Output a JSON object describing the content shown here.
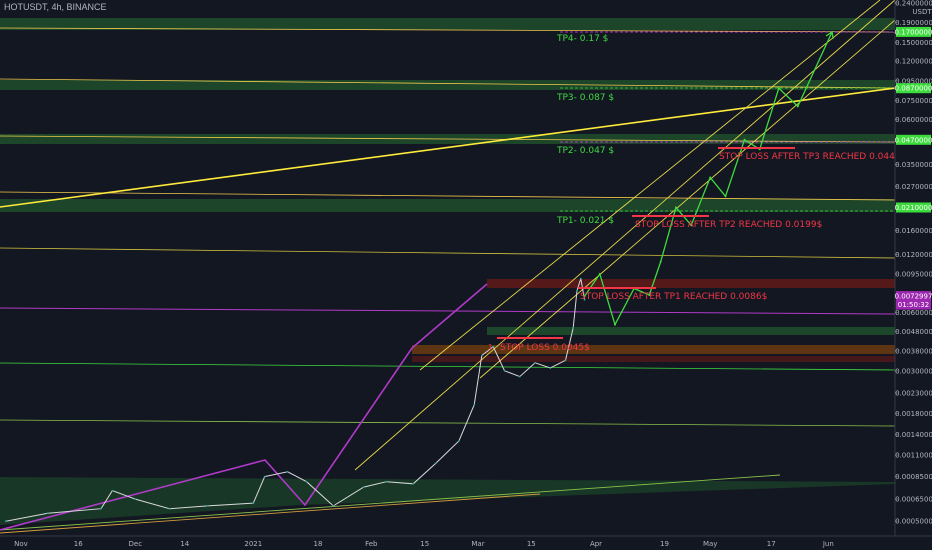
{
  "header": {
    "title": "HOTUSDT, 4h, BINANCE"
  },
  "y_axis": {
    "unit": "USDT",
    "ticks": [
      {
        "label": "0.2400000",
        "v": 0.24
      },
      {
        "label": "0.1900000",
        "v": 0.19
      },
      {
        "label": "0.1500000",
        "v": 0.15
      },
      {
        "label": "0.1200000",
        "v": 0.12
      },
      {
        "label": "0.0950000",
        "v": 0.095
      },
      {
        "label": "0.0750000",
        "v": 0.075
      },
      {
        "label": "0.0600000",
        "v": 0.06
      },
      {
        "label": "0.0350000",
        "v": 0.035
      },
      {
        "label": "0.0270000",
        "v": 0.027
      },
      {
        "label": "0.0160000",
        "v": 0.016
      },
      {
        "label": "0.0120000",
        "v": 0.012
      },
      {
        "label": "0.0095000",
        "v": 0.0095
      },
      {
        "label": "0.0060000",
        "v": 0.006
      },
      {
        "label": "0.0048000",
        "v": 0.0048
      },
      {
        "label": "0.0038000",
        "v": 0.0038
      },
      {
        "label": "0.0030000",
        "v": 0.003
      },
      {
        "label": "0.0023000",
        "v": 0.0023
      },
      {
        "label": "0.0018000",
        "v": 0.0018
      },
      {
        "label": "0.0014000",
        "v": 0.0014
      },
      {
        "label": "0.0011000",
        "v": 0.0011
      },
      {
        "label": "0.0008500",
        "v": 0.00085
      },
      {
        "label": "0.0006500",
        "v": 0.00065
      },
      {
        "label": "0.0005000",
        "v": 0.0005
      }
    ],
    "badges": [
      {
        "label": "0.1700000",
        "v": 0.17,
        "color": "#3ddc3d"
      },
      {
        "label": "0.0870000",
        "v": 0.087,
        "color": "#3ddc3d"
      },
      {
        "label": "0.0470000",
        "v": 0.047,
        "color": "#3ddc3d"
      },
      {
        "label": "0.0210000",
        "v": 0.021,
        "color": "#3ddc3d"
      },
      {
        "label": "0.0072997",
        "v": 0.0073,
        "color": "#9c27b0"
      },
      {
        "label": "01:50:32",
        "v": 0.0066,
        "color": "#9c27b0"
      }
    ]
  },
  "x_axis": {
    "ticks": [
      "Nov",
      "16",
      "Dec",
      "14",
      "2021",
      "18",
      "Feb",
      "15",
      "Mar",
      "15",
      "Apr",
      "19",
      "May",
      "17",
      "Jun"
    ]
  },
  "annotations": {
    "tp4": "TP4- 0.17 $",
    "tp3": "TP3- 0.087 $",
    "tp2": "TP2- 0.047 $",
    "tp1": "TP1- 0.021 $",
    "sl3": "STOP LOSS AFTER TP3 REACHED 0.044$",
    "sl2": "STOP LOSS AFTER TP2 REACHED 0.0199$",
    "sl1": "STOP LOSS AFTER TP1 REACHED 0.0086$",
    "sl0": "STOP LOSS 0.0045$",
    "sl0_prefix": "1"
  },
  "colors": {
    "background": "#131722",
    "zone_green": "#1b5e20",
    "zone_red": "#5d1a1a",
    "zone_orange": "#6b3b10",
    "trend_yellow": "#ffeb3b",
    "trend_purple": "#9c27b0",
    "projection": "#3ddc3d",
    "stop_loss": "#f23645"
  },
  "chart_data": {
    "type": "line",
    "title": "HOTUSDT, 4h, BINANCE",
    "y_scale": "log",
    "ylim": [
      0.00045,
      0.24
    ],
    "xlim": [
      "2020-10-27",
      "2021-06-18"
    ],
    "series": [
      {
        "values": [
          [
            "2020-10-28",
            0.0005
          ],
          [
            "2020-11-08",
            0.00055
          ],
          [
            "2020-11-22",
            0.00058
          ],
          [
            "2020-11-25",
            0.00072
          ],
          [
            "2020-12-01",
            0.00065
          ],
          [
            "2020-12-10",
            0.00058
          ],
          [
            "2020-12-20",
            0.0006
          ],
          [
            "2021-01-01",
            0.00062
          ],
          [
            "2021-01-04",
            0.00085
          ],
          [
            "2021-01-10",
            0.0009
          ],
          [
            "2021-01-15",
            0.0008
          ],
          [
            "2021-01-22",
            0.0006
          ],
          [
            "2021-01-30",
            0.00075
          ],
          [
            "2021-02-05",
            0.0008
          ],
          [
            "2021-02-12",
            0.00078
          ],
          [
            "2021-02-18",
            0.001
          ],
          [
            "2021-02-24",
            0.0013
          ],
          [
            "2021-02-28",
            0.002
          ],
          [
            "2021-03-02",
            0.0036
          ],
          [
            "2021-03-05",
            0.004
          ],
          [
            "2021-03-08",
            0.003
          ],
          [
            "2021-03-12",
            0.0028
          ],
          [
            "2021-03-16",
            0.0033
          ],
          [
            "2021-03-20",
            0.0031
          ],
          [
            "2021-03-24",
            0.0034
          ],
          [
            "2021-03-26",
            0.005
          ],
          [
            "2021-03-27",
            0.0078
          ],
          [
            "2021-03-28",
            0.009
          ],
          [
            "2021-03-29",
            0.007
          ]
        ]
      },
      {
        "name": "projection",
        "values": [
          [
            "2021-03-29",
            0.0073
          ],
          [
            "2021-04-02",
            0.0095
          ],
          [
            "2021-04-06",
            0.0052
          ],
          [
            "2021-04-11",
            0.008
          ],
          [
            "2021-04-15",
            0.0074
          ],
          [
            "2021-04-18",
            0.011
          ],
          [
            "2021-04-22",
            0.021
          ],
          [
            "2021-04-26",
            0.017
          ],
          [
            "2021-05-01",
            0.03
          ],
          [
            "2021-05-05",
            0.024
          ],
          [
            "2021-05-10",
            0.047
          ],
          [
            "2021-05-14",
            0.042
          ],
          [
            "2021-05-19",
            0.087
          ],
          [
            "2021-05-24",
            0.07
          ],
          [
            "2021-06-02",
            0.17
          ]
        ]
      }
    ],
    "levels": [
      0.17,
      0.087,
      0.047,
      0.021,
      0.0086,
      0.0073,
      0.0045
    ],
    "grid": false
  }
}
